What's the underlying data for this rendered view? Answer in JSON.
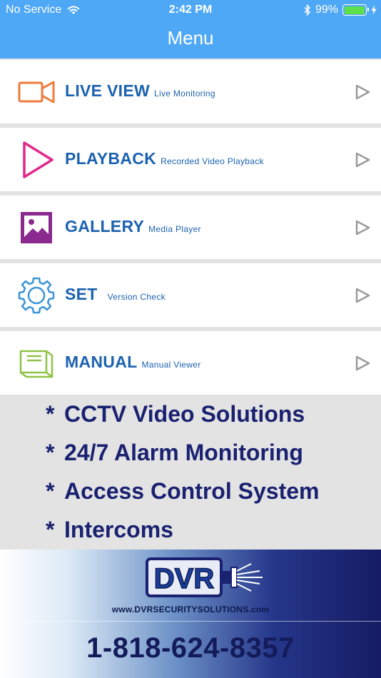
{
  "status_bar": {
    "carrier": "No Service",
    "time": "2:42 PM",
    "battery_percent": "99%",
    "battery_level": 0.99
  },
  "header": {
    "title": "Menu"
  },
  "menu": [
    {
      "title": "LIVE VIEW",
      "subtitle": "Live Monitoring",
      "icon": "video-camera-icon",
      "color": "#f07a3a"
    },
    {
      "title": "PLAYBACK",
      "subtitle": "Recorded Video Playback",
      "icon": "play-icon",
      "color": "#e0288c"
    },
    {
      "title": "GALLERY",
      "subtitle": "Media Player",
      "icon": "gallery-image-icon",
      "color": "#8b2a8e"
    },
    {
      "title": "SET",
      "subtitle": "Version Check",
      "icon": "gear-icon",
      "color": "#3b95d6"
    },
    {
      "title": "MANUAL",
      "subtitle": "Manual Viewer",
      "icon": "book-icon",
      "color": "#8fc247"
    }
  ],
  "services": [
    "CCTV Video Solutions",
    "24/7 Alarm Monitoring",
    "Access Control System",
    "Intercoms"
  ],
  "banner": {
    "logo_text": "DVR",
    "website": "www.DVRSECURITYSOLUTIONS.com",
    "phone": "1-818-624-8357"
  }
}
